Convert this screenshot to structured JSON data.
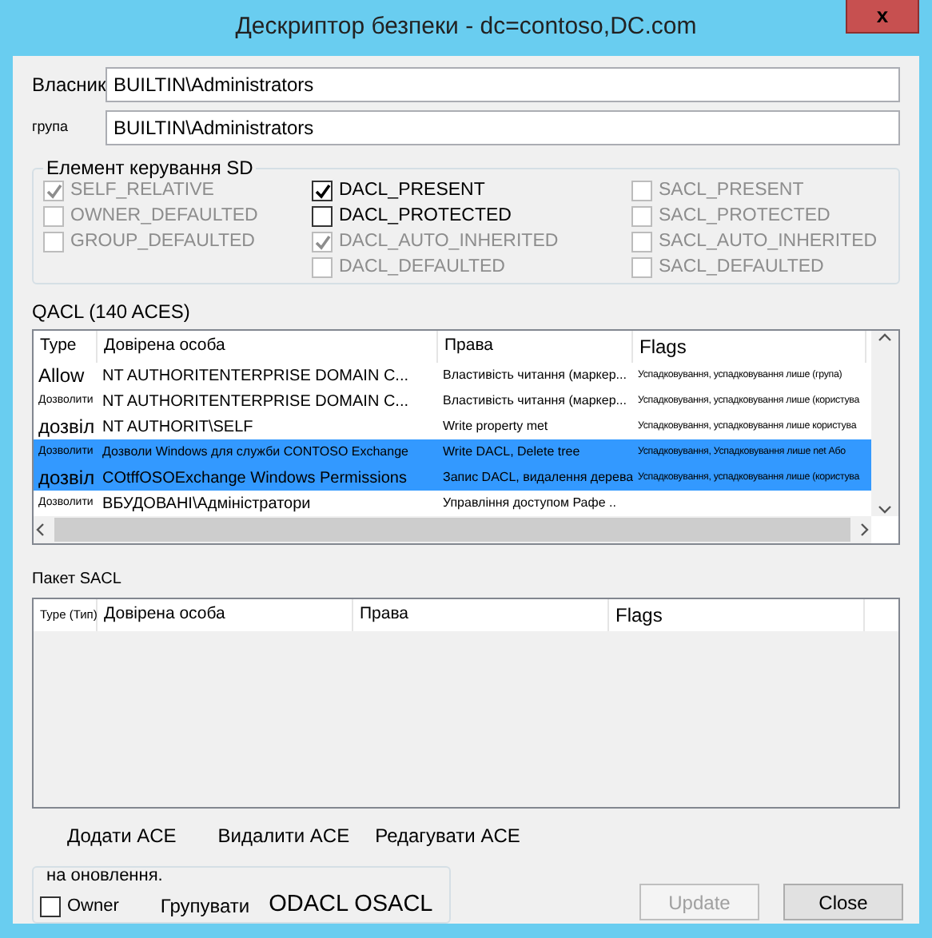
{
  "window": {
    "title": "Дескриптор безпеки - dc=contoso,DC.com",
    "close": "x"
  },
  "owner": {
    "label": "Власник",
    "value": "BUILTIN\\Administrators"
  },
  "group": {
    "label": "група",
    "value": "BUILTIN\\Administrators"
  },
  "sd_control": {
    "title": "Елемент керування SD",
    "columns": [
      [
        {
          "label": "SELF_RELATIVE",
          "checked": true,
          "disabled": true
        },
        {
          "label": "OWNER_DEFAULTED",
          "checked": false,
          "disabled": true
        },
        {
          "label": "GROUP_DEFAULTED",
          "checked": false,
          "disabled": true
        }
      ],
      [
        {
          "label": "DACL_PRESENT",
          "checked": true,
          "disabled": false
        },
        {
          "label": "DACL_PROTECTED",
          "checked": false,
          "disabled": false
        },
        {
          "label": "DACL_AUTO_INHERITED",
          "checked": true,
          "disabled": true
        },
        {
          "label": "DACL_DEFAULTED",
          "checked": false,
          "disabled": true
        }
      ],
      [
        {
          "label": "SACL_PRESENT",
          "checked": false,
          "disabled": true
        },
        {
          "label": "SACL_PROTECTED",
          "checked": false,
          "disabled": true
        },
        {
          "label": "SACL_AUTO_INHERITED",
          "checked": false,
          "disabled": true
        },
        {
          "label": "SACL_DEFAULTED",
          "checked": false,
          "disabled": true
        }
      ]
    ]
  },
  "dacl": {
    "title": "QACL (140 ACES)",
    "columns": [
      "Type",
      "Довірена особа",
      "Права",
      "Flags"
    ],
    "rows": [
      {
        "type": "Allow",
        "trustee": "NT AUTHORITENTERPRISE DOMAIN C...",
        "rights": "Властивість читання (маркер...",
        "flags": "Успадковування, успадковування лише (група)",
        "selected": false
      },
      {
        "type": "Дозволити",
        "trustee": "NT AUTHORITENTERPRISE DOMAIN C...",
        "rights": "Властивість читання (маркер...",
        "flags": "Успадковування, успадковування лише (користува",
        "selected": false
      },
      {
        "type": "дозвіл",
        "trustee": "NT AUTHORIT\\SELF",
        "rights": "Write property met",
        "flags": "Успадковування, успадковування лише користува",
        "selected": false
      },
      {
        "type": "Дозволити",
        "trustee": "Дозволи Windows для служби CONTOSO Exchange",
        "rights": "Write DACL, Delete tree",
        "flags": "Успадковування, Успадковування лише net Або",
        "selected": true
      },
      {
        "type": "дозвіл",
        "trustee": "COtffOSOExchange Windows Permissions",
        "rights": "Запис DACL, видалення дерева",
        "flags": "Успадковування, успадковування лише (користува",
        "selected": true
      },
      {
        "type": "Дозволити",
        "trustee": "ВБУДОВАНІ\\Адміністратори",
        "rights": "Управління доступом Рафе ..",
        "flags": "",
        "selected": false
      }
    ]
  },
  "sacl": {
    "title": "Пакет SACL",
    "columns": [
      "Type (Тип)",
      "Довірена особа",
      "Права",
      "Flags"
    ]
  },
  "ace_buttons": [
    "Додати ACE",
    "Видалити ACE",
    "Редагувати ACE"
  ],
  "update_group": {
    "title": "на оновлення.",
    "owner": {
      "label": "Owner",
      "checked": false
    },
    "group_label": "Групувати",
    "acl_label": "ODACL OSACL"
  },
  "buttons": [
    {
      "label": "Update",
      "disabled": true
    },
    {
      "label": "Close",
      "disabled": false
    }
  ]
}
